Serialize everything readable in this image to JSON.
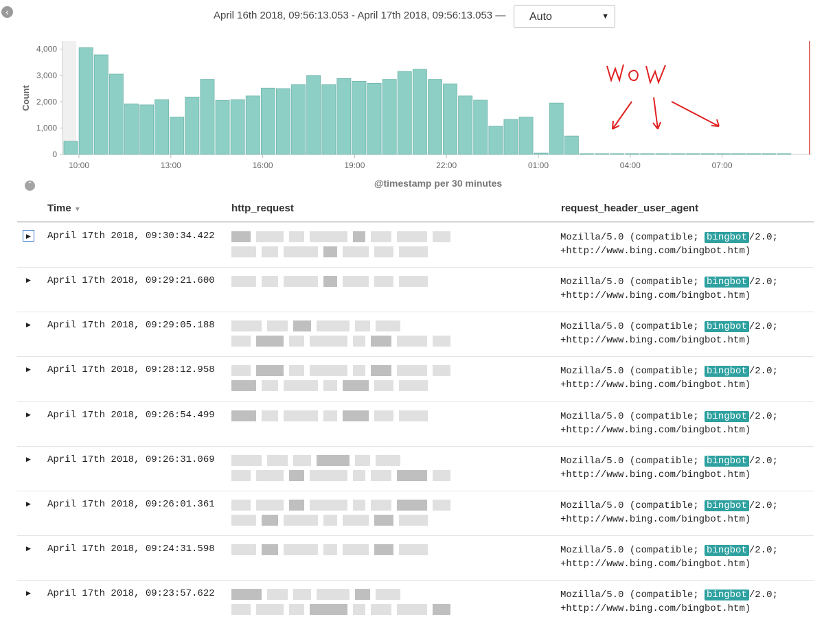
{
  "header": {
    "back_icon": "chevron-left-icon",
    "time_range": "April 16th 2018, 09:56:13.053 - April 17th 2018, 09:56:13.053 —",
    "interval_value": "Auto"
  },
  "chart_data": {
    "type": "bar",
    "ylabel": "Count",
    "xlabel": "@timestamp per 30 minutes",
    "yticks": [
      "4,000",
      "3,000",
      "2,000",
      "1,000",
      "0"
    ],
    "xticks": [
      "10:00",
      "13:00",
      "16:00",
      "19:00",
      "22:00",
      "01:00",
      "04:00",
      "07:00"
    ],
    "ylim": [
      0,
      4300
    ],
    "values": [
      500,
      4050,
      3780,
      3050,
      1920,
      1880,
      2080,
      1420,
      2180,
      2850,
      2050,
      2080,
      2220,
      2520,
      2500,
      2650,
      3000,
      2650,
      2880,
      2780,
      2700,
      2850,
      3150,
      3230,
      2850,
      2680,
      2220,
      2060,
      1070,
      1330,
      1420,
      50,
      1950,
      700,
      30,
      30,
      30,
      30,
      30,
      30,
      30,
      30,
      30,
      30,
      30,
      30,
      30,
      30
    ],
    "bar_color": "#8ecfc5",
    "annotation": "WOW"
  },
  "table": {
    "collapse_icon": "chevron-up-icon",
    "columns": {
      "time": "Time",
      "request": "http_request",
      "ua": "request_header_user_agent"
    },
    "rows": [
      {
        "time": "April 17th 2018, 09:30:34.422",
        "ua1": "Mozilla/5.0 (compatible; ",
        "hl": "bingbot",
        "ua2": "/2.0;",
        "ua3": "+http://www.bing.com/bingbot.htm)"
      },
      {
        "time": "April 17th 2018, 09:29:21.600",
        "ua1": "Mozilla/5.0 (compatible; ",
        "hl": "bingbot",
        "ua2": "/2.0;",
        "ua3": "+http://www.bing.com/bingbot.htm)"
      },
      {
        "time": "April 17th 2018, 09:29:05.188",
        "ua1": "Mozilla/5.0 (compatible; ",
        "hl": "bingbot",
        "ua2": "/2.0;",
        "ua3": "+http://www.bing.com/bingbot.htm)"
      },
      {
        "time": "April 17th 2018, 09:28:12.958",
        "ua1": "Mozilla/5.0 (compatible; ",
        "hl": "bingbot",
        "ua2": "/2.0;",
        "ua3": "+http://www.bing.com/bingbot.htm)"
      },
      {
        "time": "April 17th 2018, 09:26:54.499",
        "ua1": "Mozilla/5.0 (compatible; ",
        "hl": "bingbot",
        "ua2": "/2.0;",
        "ua3": "+http://www.bing.com/bingbot.htm)"
      },
      {
        "time": "April 17th 2018, 09:26:31.069",
        "ua1": "Mozilla/5.0 (compatible; ",
        "hl": "bingbot",
        "ua2": "/2.0;",
        "ua3": "+http://www.bing.com/bingbot.htm)"
      },
      {
        "time": "April 17th 2018, 09:26:01.361",
        "ua1": "Mozilla/5.0 (compatible; ",
        "hl": "bingbot",
        "ua2": "/2.0;",
        "ua3": "+http://www.bing.com/bingbot.htm)"
      },
      {
        "time": "April 17th 2018, 09:24:31.598",
        "ua1": "Mozilla/5.0 (compatible; ",
        "hl": "bingbot",
        "ua2": "/2.0;",
        "ua3": "+http://www.bing.com/bingbot.htm)"
      },
      {
        "time": "April 17th 2018, 09:23:57.622",
        "ua1": "Mozilla/5.0 (compatible; ",
        "hl": "bingbot",
        "ua2": "/2.0;",
        "ua3": "+http://www.bing.com/bingbot.htm)"
      }
    ]
  }
}
